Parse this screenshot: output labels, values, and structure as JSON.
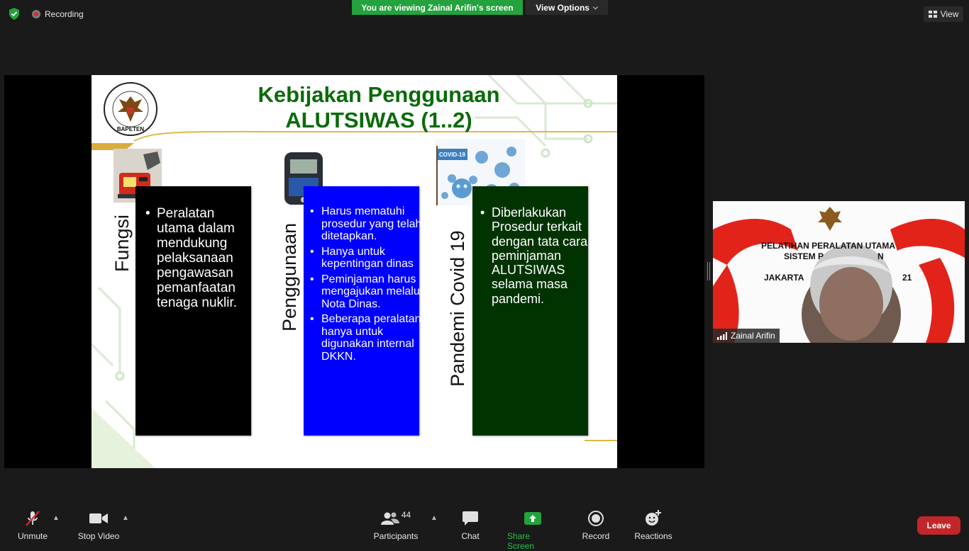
{
  "topbar": {
    "recording_label": "Recording",
    "viewing_banner": "You are viewing Zainal Arifin's screen",
    "view_options_label": "View Options",
    "view_label": "View"
  },
  "slide": {
    "title_line1": "Kebijakan Penggunaan",
    "title_line2": "ALUTSIWAS (1..2)",
    "logo_text": "BAPETEN",
    "columns": [
      {
        "label": "Fungsi",
        "bullets": [
          "Peralatan utama dalam mendukung pelaksanaan pengawasan pemanfaatan tenaga nuklir."
        ]
      },
      {
        "label": "Penggunaan",
        "bullets": [
          "Harus mematuhi prosedur yang telah ditetapkan.",
          "Hanya untuk kepentingan dinas",
          "Peminjaman harus mengajukan melalui Nota Dinas.",
          "Beberapa peralatan hanya untuk digunakan internal DKKN."
        ]
      },
      {
        "label": "Pandemi Covid 19",
        "covid_tag": "COVID-19",
        "bullets": [
          "Diberlakukan Prosedur terkait dengan tata cara peminjaman ALUTSIWAS selama masa pandemi."
        ]
      }
    ]
  },
  "video": {
    "participant_name": "Zainal Arifin",
    "banner_line1": "PELATIHAN PERALATAN UTAMA",
    "banner_line2": "SISTEM P",
    "banner_line2b": "N",
    "banner_line3": "JAKARTA",
    "banner_line3b": "21"
  },
  "toolbar": {
    "unmute": "Unmute",
    "stop_video": "Stop Video",
    "participants": "Participants",
    "participants_count": "44",
    "chat": "Chat",
    "share_screen": "Share Screen",
    "record": "Record",
    "reactions": "Reactions",
    "leave": "Leave"
  },
  "colors": {
    "share_green": "#23a23e",
    "leave_red": "#c2262a",
    "slide_title_green": "#0a6b0a",
    "box1": "#000000",
    "box2": "#0000ff",
    "box3": "#003300"
  }
}
